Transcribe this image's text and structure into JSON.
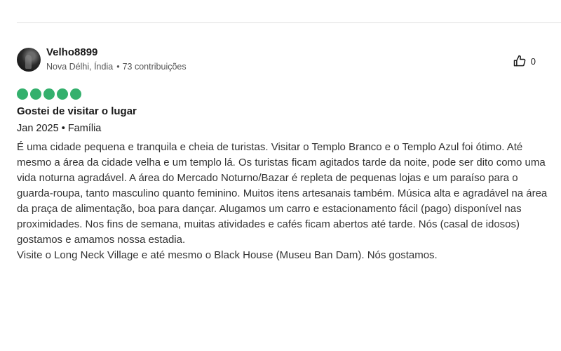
{
  "review": {
    "user": {
      "name": "Velho8899",
      "location": "Nova Délhi, Índia",
      "contributions": "73 contribuições"
    },
    "helpful": {
      "icon": "thumbs-up-icon",
      "count": "0"
    },
    "rating": {
      "value": 5,
      "max": 5,
      "color": "#34b06d"
    },
    "title": "Gostei de visitar o lugar",
    "date": "Jan 2025",
    "trip_type": "Família",
    "text": "É uma cidade pequena e tranquila e cheia de turistas. Visitar o Templo Branco e o Templo Azul foi ótimo. Até mesmo a área da cidade velha e um templo lá. Os turistas ficam agitados tarde da noite, pode ser dito como uma vida noturna agradável. A área do Mercado Noturno/Bazar é repleta de pequenas lojas e um paraíso para o guarda-roupa, tanto masculino quanto feminino. Muitos itens artesanais também. Música alta e agradável na área da praça de alimentação, boa para dançar. Alugamos um carro e estacionamento fácil (pago) disponível nas proximidades. Nos fins de semana, muitas atividades e cafés ficam abertos até tarde. Nós (casal de idosos) gostamos e amamos nossa estadia.",
    "text2": "Visite o Long Neck Village e até mesmo o Black House (Museu Ban Dam). Nós gostamos."
  }
}
